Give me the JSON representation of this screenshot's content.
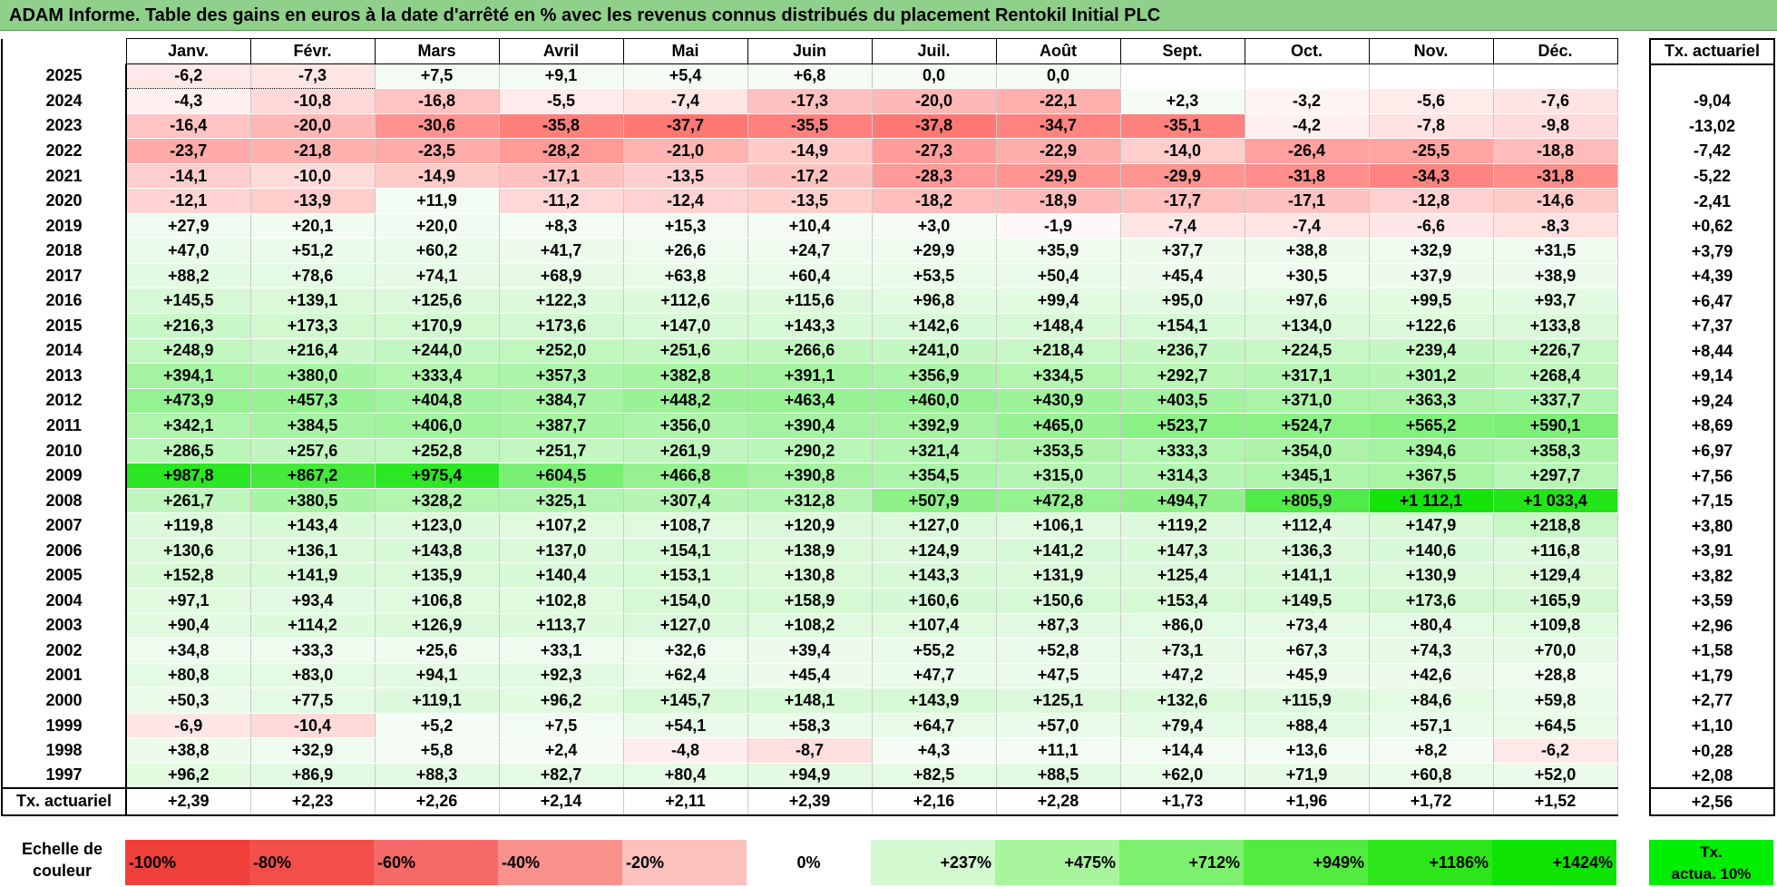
{
  "title": "ADAM Informe. Table des gains en euros à la date d'arrêté en % avec les revenus connus distribués du placement Rentokil Initial PLC",
  "months": [
    "Janv.",
    "Févr.",
    "Mars",
    "Avril",
    "Mai",
    "Juin",
    "Juil.",
    "Août",
    "Sept.",
    "Oct.",
    "Nov.",
    "Déc."
  ],
  "right_header": "Tx. actuariel",
  "rows": [
    {
      "year": "2025",
      "vals": [
        "-6,2",
        "-7,3",
        "+7,5",
        "+9,1",
        "+5,4",
        "+6,8",
        "0,0",
        "0,0",
        "",
        "",
        "",
        ""
      ],
      "ta": ""
    },
    {
      "year": "2024",
      "vals": [
        "-4,3",
        "-10,8",
        "-16,8",
        "-5,5",
        "-7,4",
        "-17,3",
        "-20,0",
        "-22,1",
        "+2,3",
        "-3,2",
        "-5,6",
        "-7,6"
      ],
      "ta": "-9,04"
    },
    {
      "year": "2023",
      "vals": [
        "-16,4",
        "-20,0",
        "-30,6",
        "-35,8",
        "-37,7",
        "-35,5",
        "-37,8",
        "-34,7",
        "-35,1",
        "-4,2",
        "-7,8",
        "-9,8"
      ],
      "ta": "-13,02"
    },
    {
      "year": "2022",
      "vals": [
        "-23,7",
        "-21,8",
        "-23,5",
        "-28,2",
        "-21,0",
        "-14,9",
        "-27,3",
        "-22,9",
        "-14,0",
        "-26,4",
        "-25,5",
        "-18,8"
      ],
      "ta": "-7,42"
    },
    {
      "year": "2021",
      "vals": [
        "-14,1",
        "-10,0",
        "-14,9",
        "-17,1",
        "-13,5",
        "-17,2",
        "-28,3",
        "-29,9",
        "-29,9",
        "-31,8",
        "-34,3",
        "-31,8"
      ],
      "ta": "-5,22"
    },
    {
      "year": "2020",
      "vals": [
        "-12,1",
        "-13,9",
        "+11,9",
        "-11,2",
        "-12,4",
        "-13,5",
        "-18,2",
        "-18,9",
        "-17,7",
        "-17,1",
        "-12,8",
        "-14,6"
      ],
      "ta": "-2,41"
    },
    {
      "year": "2019",
      "vals": [
        "+27,9",
        "+20,1",
        "+20,0",
        "+8,3",
        "+15,3",
        "+10,4",
        "+3,0",
        "-1,9",
        "-7,4",
        "-7,4",
        "-6,6",
        "-8,3"
      ],
      "ta": "+0,62"
    },
    {
      "year": "2018",
      "vals": [
        "+47,0",
        "+51,2",
        "+60,2",
        "+41,7",
        "+26,6",
        "+24,7",
        "+29,9",
        "+35,9",
        "+37,7",
        "+38,8",
        "+32,9",
        "+31,5"
      ],
      "ta": "+3,79"
    },
    {
      "year": "2017",
      "vals": [
        "+88,2",
        "+78,6",
        "+74,1",
        "+68,9",
        "+63,8",
        "+60,4",
        "+53,5",
        "+50,4",
        "+45,4",
        "+30,5",
        "+37,9",
        "+38,9"
      ],
      "ta": "+4,39"
    },
    {
      "year": "2016",
      "vals": [
        "+145,5",
        "+139,1",
        "+125,6",
        "+122,3",
        "+112,6",
        "+115,6",
        "+96,8",
        "+99,4",
        "+95,0",
        "+97,6",
        "+99,5",
        "+93,7"
      ],
      "ta": "+6,47"
    },
    {
      "year": "2015",
      "vals": [
        "+216,3",
        "+173,3",
        "+170,9",
        "+173,6",
        "+147,0",
        "+143,3",
        "+142,6",
        "+148,4",
        "+154,1",
        "+134,0",
        "+122,6",
        "+133,8"
      ],
      "ta": "+7,37"
    },
    {
      "year": "2014",
      "vals": [
        "+248,9",
        "+216,4",
        "+244,0",
        "+252,0",
        "+251,6",
        "+266,6",
        "+241,0",
        "+218,4",
        "+236,7",
        "+224,5",
        "+239,4",
        "+226,7"
      ],
      "ta": "+8,44"
    },
    {
      "year": "2013",
      "vals": [
        "+394,1",
        "+380,0",
        "+333,4",
        "+357,3",
        "+382,8",
        "+391,1",
        "+356,9",
        "+334,5",
        "+292,7",
        "+317,1",
        "+301,2",
        "+268,4"
      ],
      "ta": "+9,14"
    },
    {
      "year": "2012",
      "vals": [
        "+473,9",
        "+457,3",
        "+404,8",
        "+384,7",
        "+448,2",
        "+463,4",
        "+460,0",
        "+430,9",
        "+403,5",
        "+371,0",
        "+363,3",
        "+337,7"
      ],
      "ta": "+9,24"
    },
    {
      "year": "2011",
      "vals": [
        "+342,1",
        "+384,5",
        "+406,0",
        "+387,7",
        "+356,0",
        "+390,4",
        "+392,9",
        "+465,0",
        "+523,7",
        "+524,7",
        "+565,2",
        "+590,1"
      ],
      "ta": "+8,69"
    },
    {
      "year": "2010",
      "vals": [
        "+286,5",
        "+257,6",
        "+252,8",
        "+251,7",
        "+261,9",
        "+290,2",
        "+321,4",
        "+353,5",
        "+333,3",
        "+354,0",
        "+394,6",
        "+358,3"
      ],
      "ta": "+6,97"
    },
    {
      "year": "2009",
      "vals": [
        "+987,8",
        "+867,2",
        "+975,4",
        "+604,5",
        "+466,8",
        "+390,8",
        "+354,5",
        "+315,0",
        "+314,3",
        "+345,1",
        "+367,5",
        "+297,7"
      ],
      "ta": "+7,56"
    },
    {
      "year": "2008",
      "vals": [
        "+261,7",
        "+380,5",
        "+328,2",
        "+325,1",
        "+307,4",
        "+312,8",
        "+507,9",
        "+472,8",
        "+494,7",
        "+805,9",
        "+1 112,1",
        "+1 033,4"
      ],
      "ta": "+7,15"
    },
    {
      "year": "2007",
      "vals": [
        "+119,8",
        "+143,4",
        "+123,0",
        "+107,2",
        "+108,7",
        "+120,9",
        "+127,0",
        "+106,1",
        "+119,2",
        "+112,4",
        "+147,9",
        "+218,8"
      ],
      "ta": "+3,80"
    },
    {
      "year": "2006",
      "vals": [
        "+130,6",
        "+136,1",
        "+143,8",
        "+137,0",
        "+154,1",
        "+138,9",
        "+124,9",
        "+141,2",
        "+147,3",
        "+136,3",
        "+140,6",
        "+116,8"
      ],
      "ta": "+3,91"
    },
    {
      "year": "2005",
      "vals": [
        "+152,8",
        "+141,9",
        "+135,9",
        "+140,4",
        "+153,1",
        "+130,8",
        "+143,3",
        "+131,9",
        "+125,4",
        "+141,1",
        "+130,9",
        "+129,4"
      ],
      "ta": "+3,82"
    },
    {
      "year": "2004",
      "vals": [
        "+97,1",
        "+93,4",
        "+106,8",
        "+102,8",
        "+154,0",
        "+158,9",
        "+160,6",
        "+150,6",
        "+153,4",
        "+149,5",
        "+173,6",
        "+165,9"
      ],
      "ta": "+3,59"
    },
    {
      "year": "2003",
      "vals": [
        "+90,4",
        "+114,2",
        "+126,9",
        "+113,7",
        "+127,0",
        "+108,2",
        "+107,4",
        "+87,3",
        "+86,0",
        "+73,4",
        "+80,4",
        "+109,8"
      ],
      "ta": "+2,96"
    },
    {
      "year": "2002",
      "vals": [
        "+34,8",
        "+33,3",
        "+25,6",
        "+33,1",
        "+32,6",
        "+39,4",
        "+55,2",
        "+52,8",
        "+73,1",
        "+67,3",
        "+74,3",
        "+70,0"
      ],
      "ta": "+1,58"
    },
    {
      "year": "2001",
      "vals": [
        "+80,8",
        "+83,0",
        "+94,1",
        "+92,3",
        "+62,4",
        "+45,4",
        "+47,7",
        "+47,5",
        "+47,2",
        "+45,9",
        "+42,6",
        "+28,8"
      ],
      "ta": "+1,79"
    },
    {
      "year": "2000",
      "vals": [
        "+50,3",
        "+77,5",
        "+119,1",
        "+96,2",
        "+145,7",
        "+148,1",
        "+143,9",
        "+125,1",
        "+132,6",
        "+115,9",
        "+84,6",
        "+59,8"
      ],
      "ta": "+2,77"
    },
    {
      "year": "1999",
      "vals": [
        "-6,9",
        "-10,4",
        "+5,2",
        "+7,5",
        "+54,1",
        "+58,3",
        "+64,7",
        "+57,0",
        "+79,4",
        "+88,4",
        "+57,1",
        "+64,5"
      ],
      "ta": "+1,10"
    },
    {
      "year": "1998",
      "vals": [
        "+38,8",
        "+32,9",
        "+5,8",
        "+2,4",
        "-4,8",
        "-8,7",
        "+4,3",
        "+11,1",
        "+14,4",
        "+13,6",
        "+8,2",
        "-6,2"
      ],
      "ta": "+0,28"
    },
    {
      "year": "1997",
      "vals": [
        "+96,2",
        "+86,9",
        "+88,3",
        "+82,7",
        "+80,4",
        "+94,9",
        "+82,5",
        "+88,5",
        "+62,0",
        "+71,9",
        "+60,8",
        "+52,0"
      ],
      "ta": "+2,08"
    }
  ],
  "total": {
    "label": "Tx. actuariel",
    "vals": [
      "+2,39",
      "+2,23",
      "+2,26",
      "+2,14",
      "+2,11",
      "+2,39",
      "+2,16",
      "+2,28",
      "+1,73",
      "+1,96",
      "+1,72",
      "+1,52"
    ],
    "ta": "+2,56"
  },
  "legend": {
    "label_line1": "Echelle de",
    "label_line2": "couleur",
    "swatches": [
      {
        "text": "-100%",
        "color": "#f0403c",
        "align": "left"
      },
      {
        "text": "-80%",
        "color": "#f24e4a",
        "align": "left"
      },
      {
        "text": "-60%",
        "color": "#f56a66",
        "align": "left"
      },
      {
        "text": "-40%",
        "color": "#f8908c",
        "align": "left"
      },
      {
        "text": "-20%",
        "color": "#fcc0bd",
        "align": "left"
      },
      {
        "text": "0%",
        "color": "#ffffff",
        "align": "center"
      },
      {
        "text": "+237%",
        "color": "#d4f8cf",
        "align": "right"
      },
      {
        "text": "+475%",
        "color": "#a8f59e",
        "align": "right"
      },
      {
        "text": "+712%",
        "color": "#7ef06f",
        "align": "right"
      },
      {
        "text": "+949%",
        "color": "#52eb40",
        "align": "right"
      },
      {
        "text": "+1186%",
        "color": "#2ce61a",
        "align": "right"
      },
      {
        "text": "+1424%",
        "color": "#0fe300",
        "align": "right"
      }
    ],
    "final_line1": "Tx.",
    "final_line2": "actua. 10%"
  },
  "colors": {
    "title_bg": "#8fd08a",
    "positive_max": "#00e000",
    "negative_max": "#f03030"
  }
}
